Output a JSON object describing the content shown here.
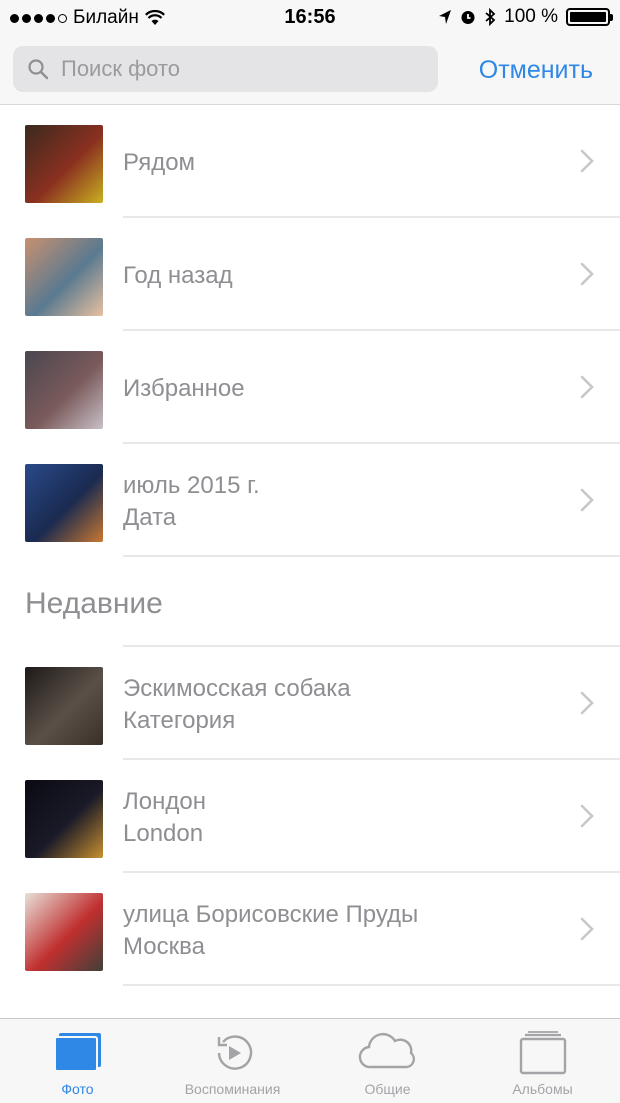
{
  "status_bar": {
    "carrier": "Билайн",
    "time": "16:56",
    "battery": "100 %",
    "signal_bars": 5,
    "signal_filled": 4
  },
  "search": {
    "placeholder": "Поиск фото",
    "cancel_label": "Отменить"
  },
  "suggestions": [
    {
      "title": "Рядом",
      "subtitle": "",
      "thumb_colors": [
        "#3a2a1e",
        "#c8b020",
        "#8a3020"
      ]
    },
    {
      "title": "Год назад",
      "subtitle": "",
      "thumb_colors": [
        "#c89070",
        "#e8c0a0",
        "#5a7a90"
      ]
    },
    {
      "title": "Избранное",
      "subtitle": "",
      "thumb_colors": [
        "#4a4650",
        "#c8c0c8",
        "#7a5a5a"
      ]
    },
    {
      "title": "июль 2015 г.",
      "subtitle": "Дата",
      "thumb_colors": [
        "#2a4a8a",
        "#c87830",
        "#1a2a50"
      ]
    }
  ],
  "recent_section_title": "Недавние",
  "recent": [
    {
      "title": "Эскимосская собака",
      "subtitle": "Категория",
      "thumb_colors": [
        "#1e1a18",
        "#3a3028",
        "#5a5048"
      ]
    },
    {
      "title": "Лондон",
      "subtitle": "London",
      "thumb_colors": [
        "#0a0a12",
        "#c89030",
        "#1a1a28"
      ]
    },
    {
      "title": "улица Борисовские Пруды",
      "subtitle": "Москва",
      "thumb_colors": [
        "#e8e0d8",
        "#40403a",
        "#c03030"
      ]
    }
  ],
  "tabs": [
    {
      "label": "Фото",
      "icon": "photos-icon",
      "active": true
    },
    {
      "label": "Воспоминания",
      "icon": "memories-icon",
      "active": false
    },
    {
      "label": "Общие",
      "icon": "cloud-icon",
      "active": false
    },
    {
      "label": "Альбомы",
      "icon": "albums-icon",
      "active": false
    }
  ],
  "colors": {
    "accent": "#2f87e6",
    "text_gray": "#8e8e93",
    "bar_background": "#f7f7f7"
  }
}
